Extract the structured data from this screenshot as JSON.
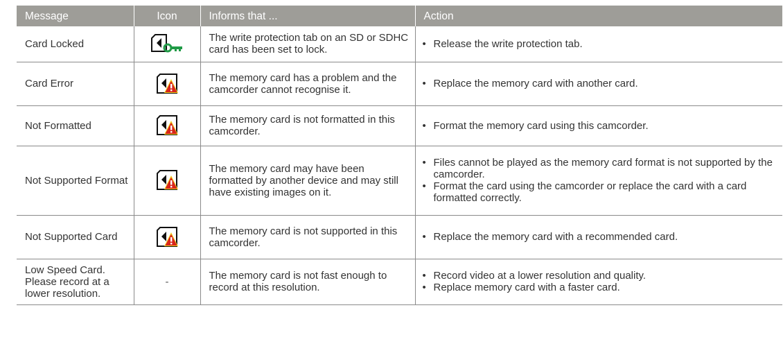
{
  "headers": {
    "message": "Message",
    "icon": "Icon",
    "informs": "Informs that ...",
    "action": "Action"
  },
  "rows": [
    {
      "message": "Card Locked",
      "icon": "card-locked-icon",
      "informs": "The write protection tab on an SD or SDHC card has been set to lock.",
      "actions": [
        "Release the write protection tab."
      ]
    },
    {
      "message": "Card Error",
      "icon": "card-warning-icon",
      "informs": "The memory card has a problem and the camcorder  cannot recognise it.",
      "actions": [
        "Replace the memory card with another card."
      ]
    },
    {
      "message": "Not Formatted",
      "icon": "card-warning-icon",
      "informs": "The memory card is not formatted in this camcorder.",
      "actions": [
        "Format the memory card using this camcorder."
      ]
    },
    {
      "message": "Not Supported Format",
      "icon": "card-warning-icon",
      "informs": "The memory card may have been formatted by another device and may still have existing images on it.",
      "actions": [
        "Files cannot be played as the memory card format is not supported by the camcorder.",
        "Format the card using the camcorder or replace the card with a card formatted correctly."
      ]
    },
    {
      "message": "Not Supported Card",
      "icon": "card-warning-icon",
      "informs": "The memory card is not supported in this camcorder.",
      "actions": [
        "Replace the memory card with a recommended card."
      ]
    },
    {
      "message": "Low Speed Card. Please record at a lower resolution.",
      "icon": "none",
      "icon_text": "-",
      "informs": "The memory card is not fast enough to record at this resolution.",
      "actions": [
        "Record video at a lower resolution and quality.",
        "Replace memory card with a faster card."
      ]
    }
  ],
  "colors": {
    "header_bg": "#9e9d98",
    "header_text": "#ffffff",
    "key_green": "#1f9a46",
    "warning_red": "#d8251c",
    "warning_yellow": "#f4d21f"
  }
}
